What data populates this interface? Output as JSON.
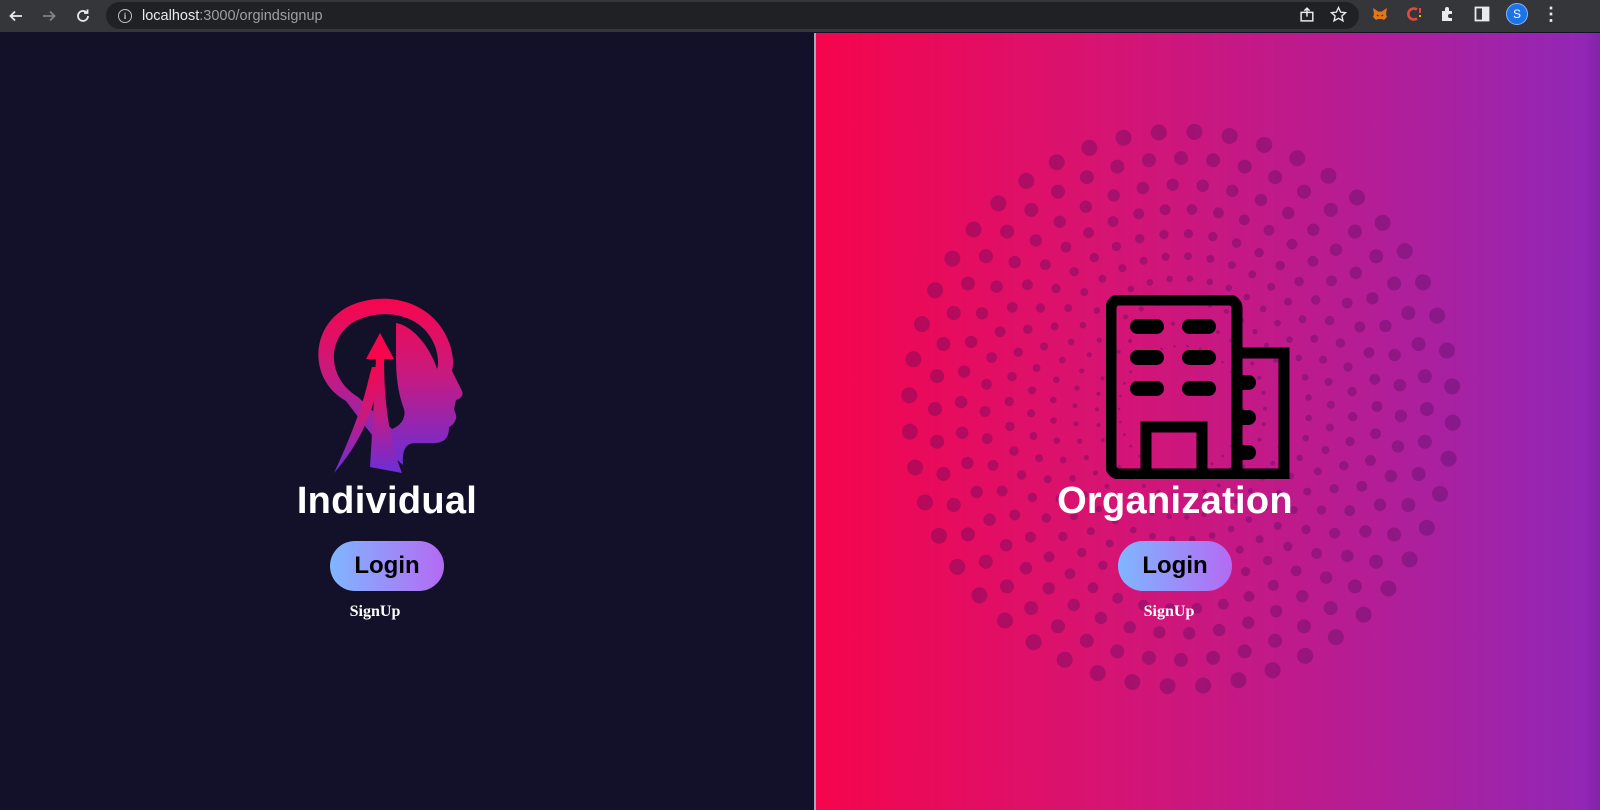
{
  "browser": {
    "url_host": "localhost",
    "url_path": ":3000/orgindsignup"
  },
  "individual": {
    "title": "Individual",
    "login_label": "Login",
    "signup_label": "SignUp",
    "icon": "head-arrow-icon"
  },
  "organization": {
    "title": "Organization",
    "login_label": "Login",
    "signup_label": "SignUp",
    "icon": "building-icon"
  },
  "profile_initial": "S",
  "colors": {
    "left_bg": "#13112a",
    "right_gradient_start": "#f5054c",
    "right_gradient_end": "#8f28b8",
    "button_gradient_start": "#7fb6ff",
    "button_gradient_end": "#b46af3"
  }
}
